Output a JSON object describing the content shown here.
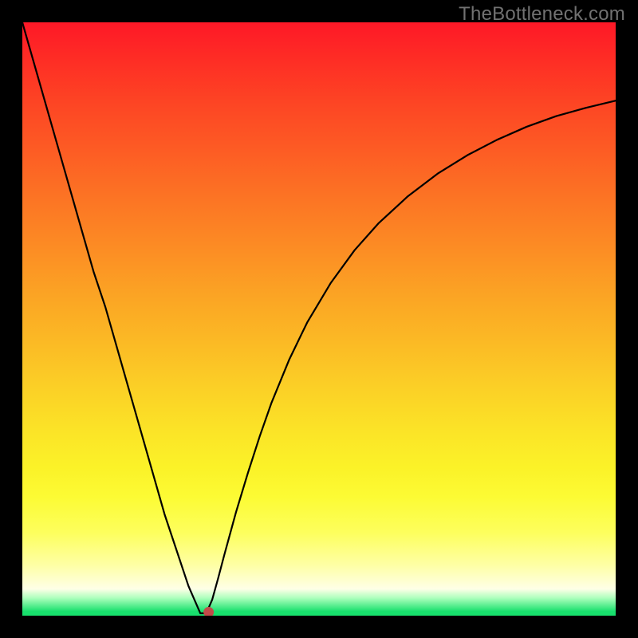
{
  "watermark": "TheBottleneck.com",
  "chart_data": {
    "type": "line",
    "title": "",
    "xlabel": "",
    "ylabel": "",
    "xlim": [
      0,
      1
    ],
    "ylim": [
      0,
      1
    ],
    "x": [
      0.0,
      0.02,
      0.04,
      0.06,
      0.08,
      0.1,
      0.12,
      0.14,
      0.16,
      0.18,
      0.2,
      0.22,
      0.24,
      0.26,
      0.28,
      0.3,
      0.305,
      0.31,
      0.32,
      0.33,
      0.34,
      0.36,
      0.38,
      0.4,
      0.42,
      0.45,
      0.48,
      0.52,
      0.56,
      0.6,
      0.65,
      0.7,
      0.75,
      0.8,
      0.85,
      0.9,
      0.95,
      1.0
    ],
    "values": [
      1.0,
      0.93,
      0.86,
      0.79,
      0.72,
      0.65,
      0.58,
      0.52,
      0.45,
      0.38,
      0.31,
      0.24,
      0.17,
      0.11,
      0.05,
      0.004,
      0.004,
      0.004,
      0.027,
      0.063,
      0.101,
      0.174,
      0.24,
      0.302,
      0.359,
      0.432,
      0.494,
      0.561,
      0.616,
      0.661,
      0.707,
      0.745,
      0.776,
      0.802,
      0.824,
      0.842,
      0.856,
      0.868
    ],
    "marker": {
      "x": 0.314,
      "y": 0.006,
      "color": "#c24b49"
    },
    "gradient_stops": [
      {
        "pos": 0.0,
        "color": "#fe1827"
      },
      {
        "pos": 0.38,
        "color": "#fc8c24"
      },
      {
        "pos": 0.75,
        "color": "#fbf228"
      },
      {
        "pos": 0.97,
        "color": "#aeffbd"
      },
      {
        "pos": 1.0,
        "color": "#18e06d"
      }
    ]
  }
}
